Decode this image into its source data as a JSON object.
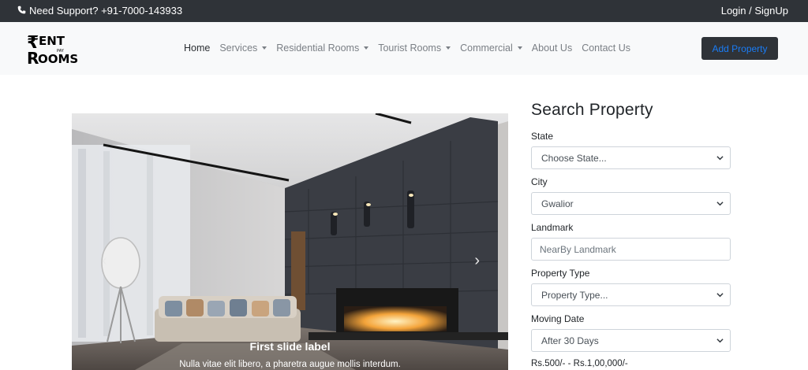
{
  "topbar": {
    "support_text": "Need Support? +91-7000-143933",
    "login_text": "Login / SignUp"
  },
  "brand": {
    "logo_line1": "ENT",
    "logo_line2": "OOMS",
    "logo_small": "PAY"
  },
  "nav": {
    "items": [
      {
        "label": "Home",
        "has_dropdown": false
      },
      {
        "label": "Services",
        "has_dropdown": true
      },
      {
        "label": "Residential Rooms",
        "has_dropdown": true
      },
      {
        "label": "Tourist Rooms",
        "has_dropdown": true
      },
      {
        "label": "Commercial",
        "has_dropdown": true
      },
      {
        "label": "About Us",
        "has_dropdown": false
      },
      {
        "label": "Contact Us",
        "has_dropdown": false
      }
    ],
    "add_property_label": "Add Property"
  },
  "carousel": {
    "caption_title": "First slide label",
    "caption_text": "Nulla vitae elit libero, a pharetra augue mollis interdum."
  },
  "search": {
    "title": "Search Property",
    "state_label": "State",
    "state_value": "Choose State...",
    "city_label": "City",
    "city_value": "Gwalior",
    "landmark_label": "Landmark",
    "landmark_placeholder": "NearBy Landmark",
    "type_label": "Property Type",
    "type_value": "Property Type...",
    "moving_label": "Moving Date",
    "moving_value": "After 30 Days",
    "price_range": "Rs.500/- - Rs.1,00,000/-"
  },
  "colors": {
    "topbar_bg": "#2f3338",
    "navbar_bg": "#f8f9fa",
    "button_text": "#1a7cf5"
  }
}
